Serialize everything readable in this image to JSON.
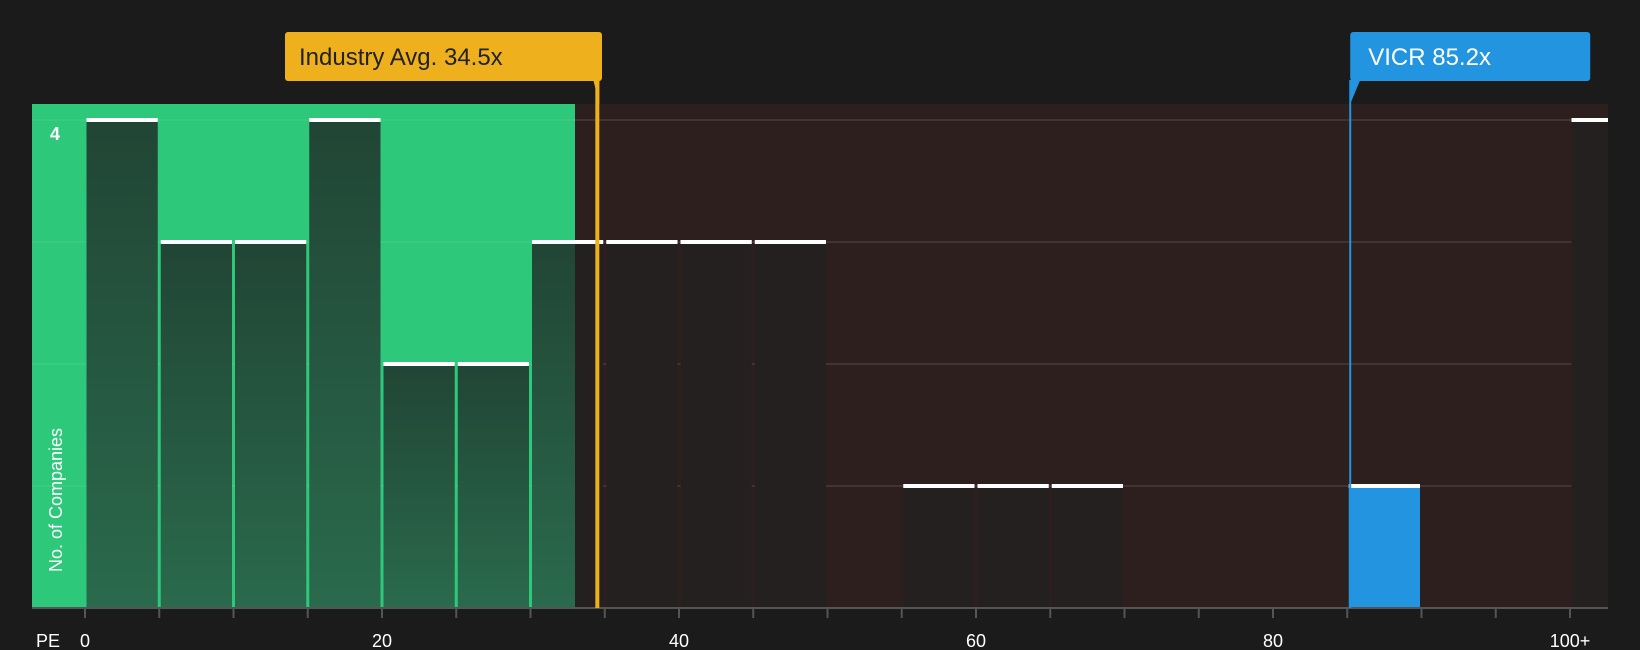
{
  "chart_data": {
    "type": "bar",
    "xlabel": "PE",
    "ylabel": "No. of Companies",
    "x_ticks": [
      "0",
      "20",
      "40",
      "60",
      "80",
      "100+"
    ],
    "y_ticks": [
      "4"
    ],
    "xlim": [
      0,
      102
    ],
    "ylim": [
      0,
      4
    ],
    "bin_width": 5,
    "bins": [
      {
        "start": 0,
        "count": 4
      },
      {
        "start": 5,
        "count": 3
      },
      {
        "start": 10,
        "count": 3
      },
      {
        "start": 15,
        "count": 4
      },
      {
        "start": 20,
        "count": 2
      },
      {
        "start": 25,
        "count": 2
      },
      {
        "start": 30,
        "count": 3
      },
      {
        "start": 35,
        "count": 3
      },
      {
        "start": 40,
        "count": 3
      },
      {
        "start": 45,
        "count": 3
      },
      {
        "start": 55,
        "count": 1
      },
      {
        "start": 60,
        "count": 1
      },
      {
        "start": 65,
        "count": 1
      },
      {
        "start": 85,
        "count": 1,
        "highlight": true
      },
      {
        "start": 100,
        "count": 4
      }
    ],
    "fair_range": [
      0,
      33
    ],
    "industry_avg": {
      "label": "Industry Avg. 34.5x",
      "value": 34.5
    },
    "company": {
      "label": "VICR 85.2x",
      "value": 85.2
    },
    "colors": {
      "background": "#1b1b1b",
      "fair_zone": "#2ec87b",
      "over_zone": "#2e1f1f",
      "bar_in_fair": "#22483a",
      "bar_default": "#242020",
      "bar_highlight": "#2394df",
      "industry": "#eeb11d",
      "company": "#2394df",
      "cap": "#ffffff",
      "axis": "#555555",
      "grid": "#4a3c3c"
    }
  }
}
